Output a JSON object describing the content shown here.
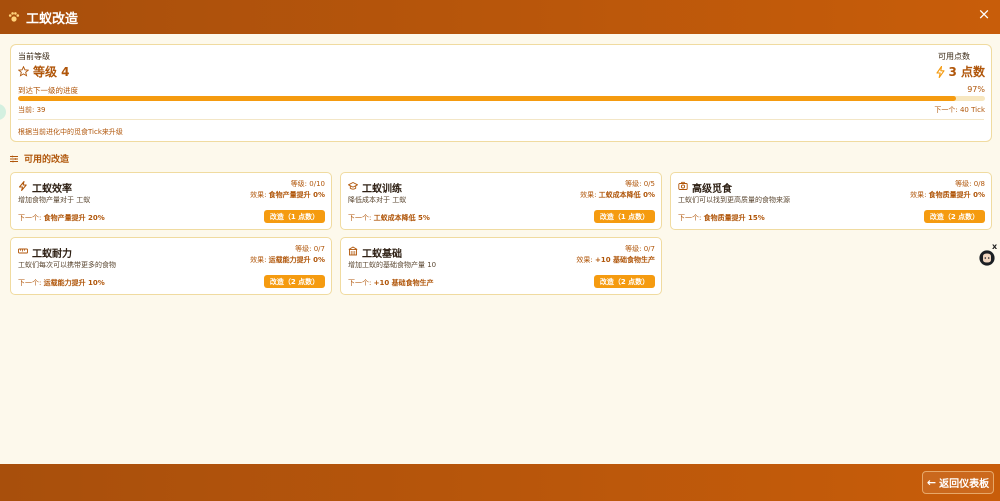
{
  "header": {
    "title": "工蚁改造",
    "close": "×"
  },
  "level": {
    "current_label": "当前等级",
    "current_value": "等级 4",
    "points_label": "可用点数",
    "points_value": "3 点数",
    "progress_label": "到达下一级的进度",
    "progress_percent": "97%",
    "progress_fraction": 0.97,
    "current_text": "当前: 39",
    "next_text": "下一个: 40 Tick",
    "note": "根据当前进化中的觅食Tick来升级"
  },
  "section": {
    "title": "可用的改造"
  },
  "cards": [
    {
      "icon": "lightning-icon",
      "name": "工蚁效率",
      "desc": "增加食物产量对于 工蚁",
      "level": "等级: 0/10",
      "effect_prefix": "效果: ",
      "effect": "食物产量提升 0%",
      "next_prefix": "下一个: ",
      "next": "食物产量提升 20%",
      "button": "改造（1 点数）"
    },
    {
      "icon": "graduation-cap-icon",
      "name": "工蚁训练",
      "desc": "降低成本对于 工蚁",
      "level": "等级: 0/5",
      "effect_prefix": "效果: ",
      "effect": "工蚁成本降低 0%",
      "next_prefix": "下一个: ",
      "next": "工蚁成本降低 5%",
      "button": "改造（1 点数）"
    },
    {
      "icon": "camera-icon",
      "name": "高级觅食",
      "desc": "工蚁们可以找到更高质量的食物来源",
      "level": "等级: 0/8",
      "effect_prefix": "效果: ",
      "effect": "食物质量提升 0%",
      "next_prefix": "下一个: ",
      "next": "食物质量提升 15%",
      "button": "改造（2 点数）"
    },
    {
      "icon": "ruler-icon",
      "name": "工蚁耐力",
      "desc": "工蚁们每次可以携带更多的食物",
      "level": "等级: 0/7",
      "effect_prefix": "效果: ",
      "effect": "运载能力提升 0%",
      "next_prefix": "下一个: ",
      "next": "运载能力提升 10%",
      "button": "改造（2 点数）"
    },
    {
      "icon": "building-icon",
      "name": "工蚁基础",
      "desc": "增加工蚁的基础食物产量 10",
      "level": "等级: 0/7",
      "effect_prefix": "效果: ",
      "effect": "+10 基础食物生产",
      "next_prefix": "下一个: ",
      "next": "+10 基础食物生产",
      "button": "改造（2 点数）"
    }
  ],
  "footer": {
    "back_label": "返回仪表板",
    "back_arrow": "←"
  },
  "widget": {
    "close": "x"
  },
  "colors": {
    "accent": "#f59b10",
    "header": "#b4550b",
    "text_accent": "#b0560a",
    "background": "#fdf9ec"
  }
}
